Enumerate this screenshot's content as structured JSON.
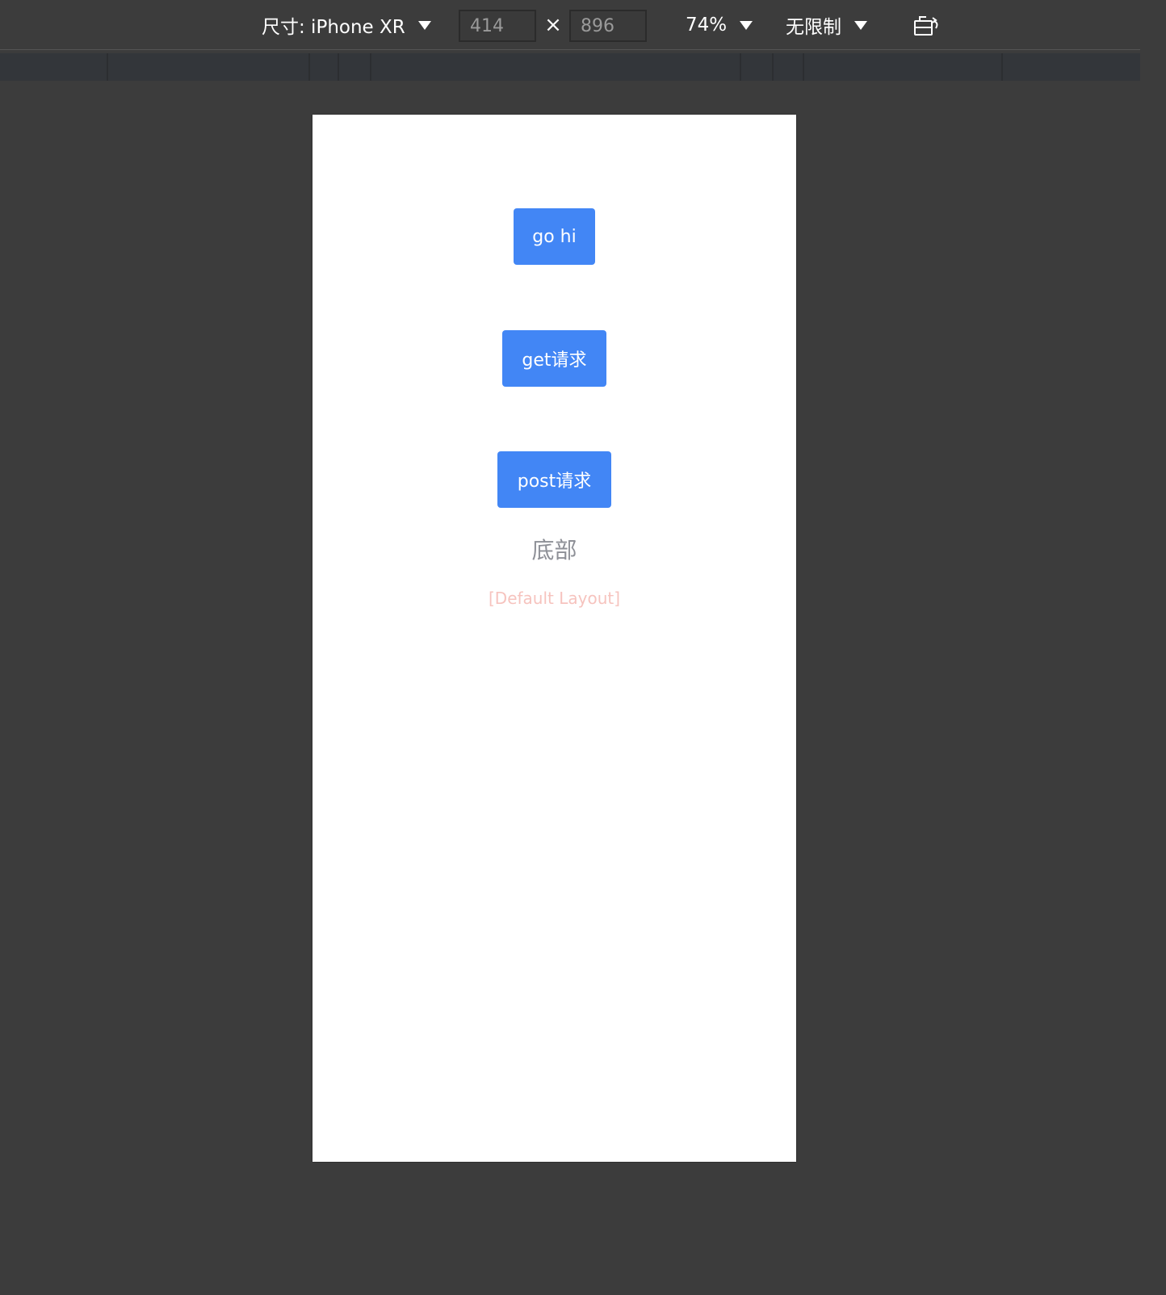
{
  "toolbar": {
    "size_label": "尺寸: iPhone XR",
    "width_value": "414",
    "times_symbol": "×",
    "height_value": "896",
    "zoom_label": "74%",
    "throttle_label": "无限制",
    "rotate_icon": "rotate-device-icon"
  },
  "app": {
    "buttons": {
      "go_hi": "go hi",
      "get_request": "get请求",
      "post_request": "post请求"
    },
    "footer_text": "底部",
    "layout_label": "[Default Layout]"
  },
  "colors": {
    "button_bg": "#4286f5",
    "footer_text": "#8e9097",
    "layout_label": "#f6c3be",
    "toolbar_bg": "#3c3c3c"
  }
}
